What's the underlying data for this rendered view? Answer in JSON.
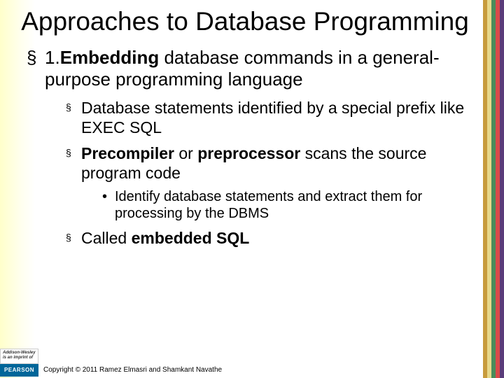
{
  "title": "Approaches to Database Programming",
  "lvl1": {
    "prefix": "1.",
    "bold": "Embedding",
    "rest": " database commands in a general-purpose programming language"
  },
  "lvl2a": "Database statements identified by a special prefix like EXEC SQL",
  "lvl2b": {
    "bold": "Precompiler",
    "mid": " or ",
    "bold2": "preprocessor",
    "rest": " scans the source program code"
  },
  "lvl3a": "Identify database statements and extract them for processing by the DBMS",
  "lvl2c": {
    "pre": "Called ",
    "bold": "embedded SQL"
  },
  "logo": {
    "line1": "Addison-Wesley",
    "line2": "is an imprint of",
    "brand": "PEARSON"
  },
  "copyright": "Copyright © 2011 Ramez Elmasri and Shamkant Navathe"
}
